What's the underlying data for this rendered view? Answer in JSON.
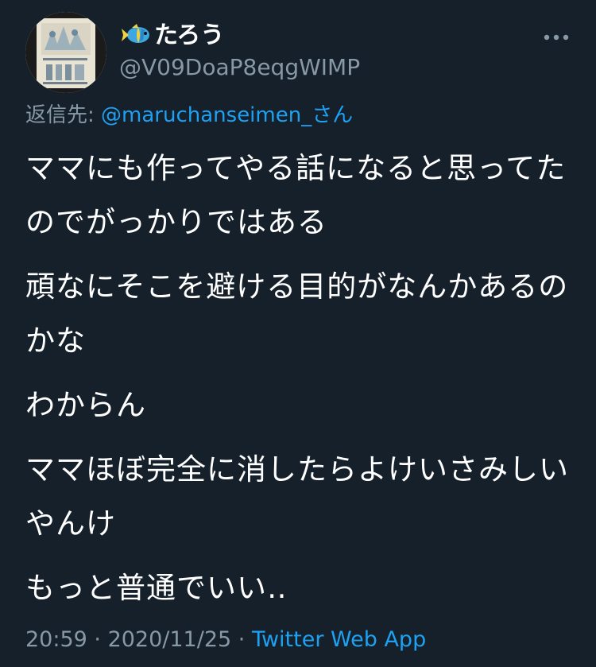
{
  "user": {
    "display_name": "たろう",
    "handle": "@V09DoaP8eqgWIMP",
    "name_emoji": "tropical-fish-icon"
  },
  "reply": {
    "prefix": "返信先: ",
    "mention": "@maruchanseimen_さん"
  },
  "tweet": {
    "paragraphs": [
      "ママにも作ってやる話になると思ってたのでがっかりではある",
      "頑なにそこを避ける目的がなんかあるのかな",
      "わからん",
      "ママほぼ完全に消したらよけいさみしいやんけ",
      "もっと普通でいい‥"
    ]
  },
  "meta": {
    "time": "20:59",
    "separator": " · ",
    "date": "2020/11/25",
    "separator2": " · ",
    "source": "Twitter Web App"
  },
  "colors": {
    "background": "#15202b",
    "text": "#ffffff",
    "secondary": "#8899a6",
    "accent": "#1da1f2"
  }
}
